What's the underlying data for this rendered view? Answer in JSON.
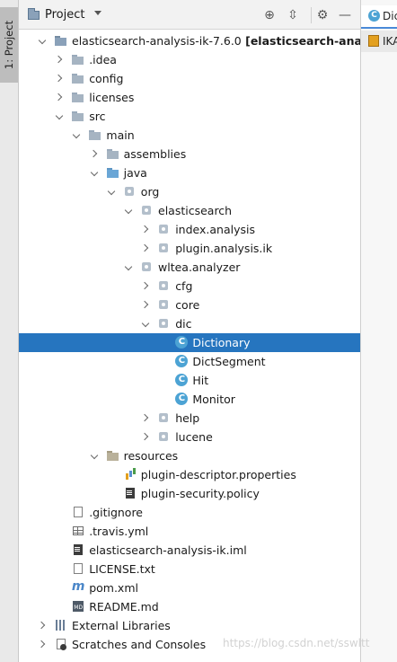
{
  "side_strip": {
    "tab_label": "1: Project"
  },
  "header": {
    "title": "Project"
  },
  "tree": [
    {
      "label": "elasticsearch-analysis-ik-7.6.0",
      "suffix": " [elasticsearch-analysis-ik]",
      "icon": "module-folder-icon",
      "state": "open"
    },
    {
      "label": ".idea",
      "icon": "folder-icon",
      "state": "closed"
    },
    {
      "label": "config",
      "icon": "folder-icon",
      "state": "closed"
    },
    {
      "label": "licenses",
      "icon": "folder-icon",
      "state": "closed"
    },
    {
      "label": "src",
      "icon": "folder-icon",
      "state": "open"
    },
    {
      "label": "main",
      "icon": "folder-icon",
      "state": "open"
    },
    {
      "label": "assemblies",
      "icon": "folder-icon",
      "state": "closed"
    },
    {
      "label": "java",
      "icon": "source-folder-icon",
      "state": "open"
    },
    {
      "label": "org",
      "icon": "package-icon",
      "state": "open"
    },
    {
      "label": "elasticsearch",
      "icon": "package-icon",
      "state": "open"
    },
    {
      "label": "index.analysis",
      "icon": "package-icon",
      "state": "closed"
    },
    {
      "label": "plugin.analysis.ik",
      "icon": "package-icon",
      "state": "closed"
    },
    {
      "label": "wltea.analyzer",
      "icon": "package-icon",
      "state": "open"
    },
    {
      "label": "cfg",
      "icon": "package-icon",
      "state": "closed"
    },
    {
      "label": "core",
      "icon": "package-icon",
      "state": "closed"
    },
    {
      "label": "dic",
      "icon": "package-icon",
      "state": "open"
    },
    {
      "label": "Dictionary",
      "icon": "class-icon",
      "state": "none",
      "selected": true
    },
    {
      "label": "DictSegment",
      "icon": "class-icon",
      "state": "none"
    },
    {
      "label": "Hit",
      "icon": "class-icon",
      "state": "none"
    },
    {
      "label": "Monitor",
      "icon": "class-icon",
      "state": "none"
    },
    {
      "label": "help",
      "icon": "package-icon",
      "state": "closed"
    },
    {
      "label": "lucene",
      "icon": "package-icon",
      "state": "closed"
    },
    {
      "label": "resources",
      "icon": "resources-folder-icon",
      "state": "open"
    },
    {
      "label": "plugin-descriptor.properties",
      "icon": "properties-file-icon",
      "state": "none"
    },
    {
      "label": "plugin-security.policy",
      "icon": "policy-file-icon",
      "state": "none"
    },
    {
      "label": ".gitignore",
      "icon": "text-file-icon",
      "state": "none"
    },
    {
      "label": ".travis.yml",
      "icon": "yaml-file-icon",
      "state": "none"
    },
    {
      "label": "elasticsearch-analysis-ik.iml",
      "icon": "iml-file-icon",
      "state": "none"
    },
    {
      "label": "LICENSE.txt",
      "icon": "text-file-icon",
      "state": "none"
    },
    {
      "label": "pom.xml",
      "icon": "maven-icon",
      "state": "none"
    },
    {
      "label": "README.md",
      "icon": "markdown-file-icon",
      "state": "none"
    },
    {
      "label": "External Libraries",
      "icon": "libraries-icon",
      "state": "closed"
    },
    {
      "label": "Scratches and Consoles",
      "icon": "scratches-icon",
      "state": "closed"
    }
  ],
  "editor_tabs": [
    {
      "label": "Dictionary.java",
      "icon": "class-icon",
      "active": true
    },
    {
      "label": "IKAnalyzer.cfg.xml",
      "icon": "xml-file-icon",
      "active": false
    }
  ],
  "watermark": "https://blog.csdn.net/sswltt",
  "colors": {
    "selection": "#2675bf",
    "class_icon": "#4ca3d4",
    "source_folder": "#6aa6d6"
  }
}
